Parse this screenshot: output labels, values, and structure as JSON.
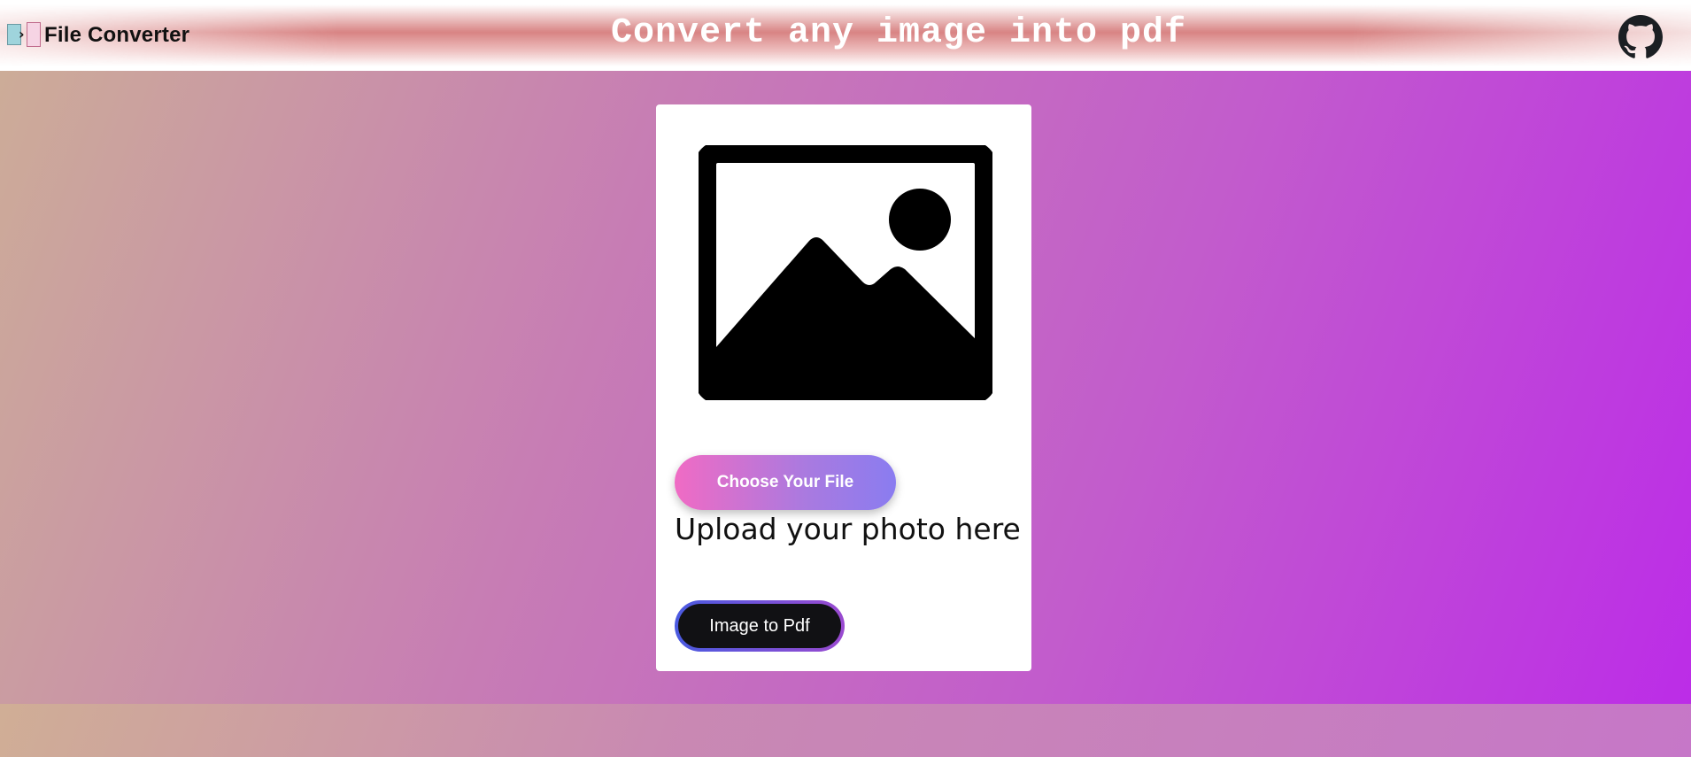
{
  "header": {
    "brand_name": "File Converter",
    "title": "Convert any image into pdf",
    "github_icon": "github-icon",
    "logo_icon": "file-convert-logo-icon"
  },
  "card": {
    "preview_icon": "image-placeholder-icon",
    "choose_file_label": "Choose Your File",
    "upload_caption": "Upload your photo here",
    "convert_label": "Image to Pdf"
  },
  "colors": {
    "header_accent": "#d67d7d",
    "background_start": "#ccac98",
    "background_end": "#bc2be8",
    "choose_button_start": "#f06bc4",
    "choose_button_end": "#8a7cf0",
    "convert_button_bg": "#111114"
  }
}
